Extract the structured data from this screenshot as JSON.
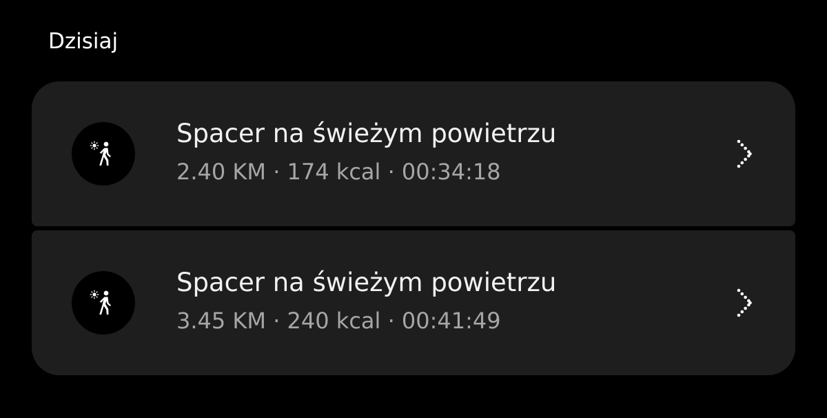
{
  "section": {
    "title": "Dzisiaj"
  },
  "activities": [
    {
      "title": "Spacer na świeżym powietrzu",
      "stats": "2.40 KM · 174 kcal · 00:34:18",
      "icon": "outdoor-walk-icon",
      "action_icon": "chevron-right-icon"
    },
    {
      "title": "Spacer na świeżym powietrzu",
      "stats": "3.45 KM · 240 kcal · 00:41:49",
      "icon": "outdoor-walk-icon",
      "action_icon": "chevron-right-icon"
    }
  ],
  "colors": {
    "background": "#000000",
    "card": "#1e1e1e",
    "title_text": "#f2f2f2",
    "secondary_text": "#a6a6a6"
  }
}
